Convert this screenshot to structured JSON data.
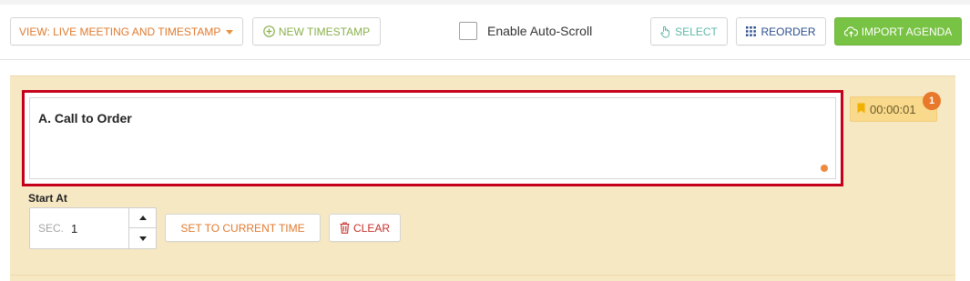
{
  "toolbar": {
    "view_label": "VIEW: LIVE MEETING AND TIMESTAMP",
    "new_timestamp_label": "NEW TIMESTAMP",
    "auto_scroll_label": "Enable Auto-Scroll",
    "auto_scroll_checked": false,
    "select_label": "SELECT",
    "reorder_label": "REORDER",
    "import_agenda_label": "IMPORT AGENDA"
  },
  "item": {
    "title": "A. Call to Order",
    "timestamp": "00:00:01",
    "badge_count": "1",
    "start_at_label": "Start At",
    "sec_prefix": "SEC.",
    "sec_value": "1",
    "set_current_label": "SET TO CURRENT TIME",
    "clear_label": "CLEAR"
  },
  "colors": {
    "accent_orange": "#e07a2e",
    "accent_green": "#78c244",
    "selection_red": "#c4001a",
    "panel_bg": "#f7e8c4"
  },
  "icons": [
    "caret-down-icon",
    "plus-circle-icon",
    "hand-pointer-icon",
    "grid-dots-icon",
    "cloud-upload-icon",
    "bookmark-icon",
    "trash-icon",
    "arrow-up-icon",
    "arrow-down-icon"
  ]
}
